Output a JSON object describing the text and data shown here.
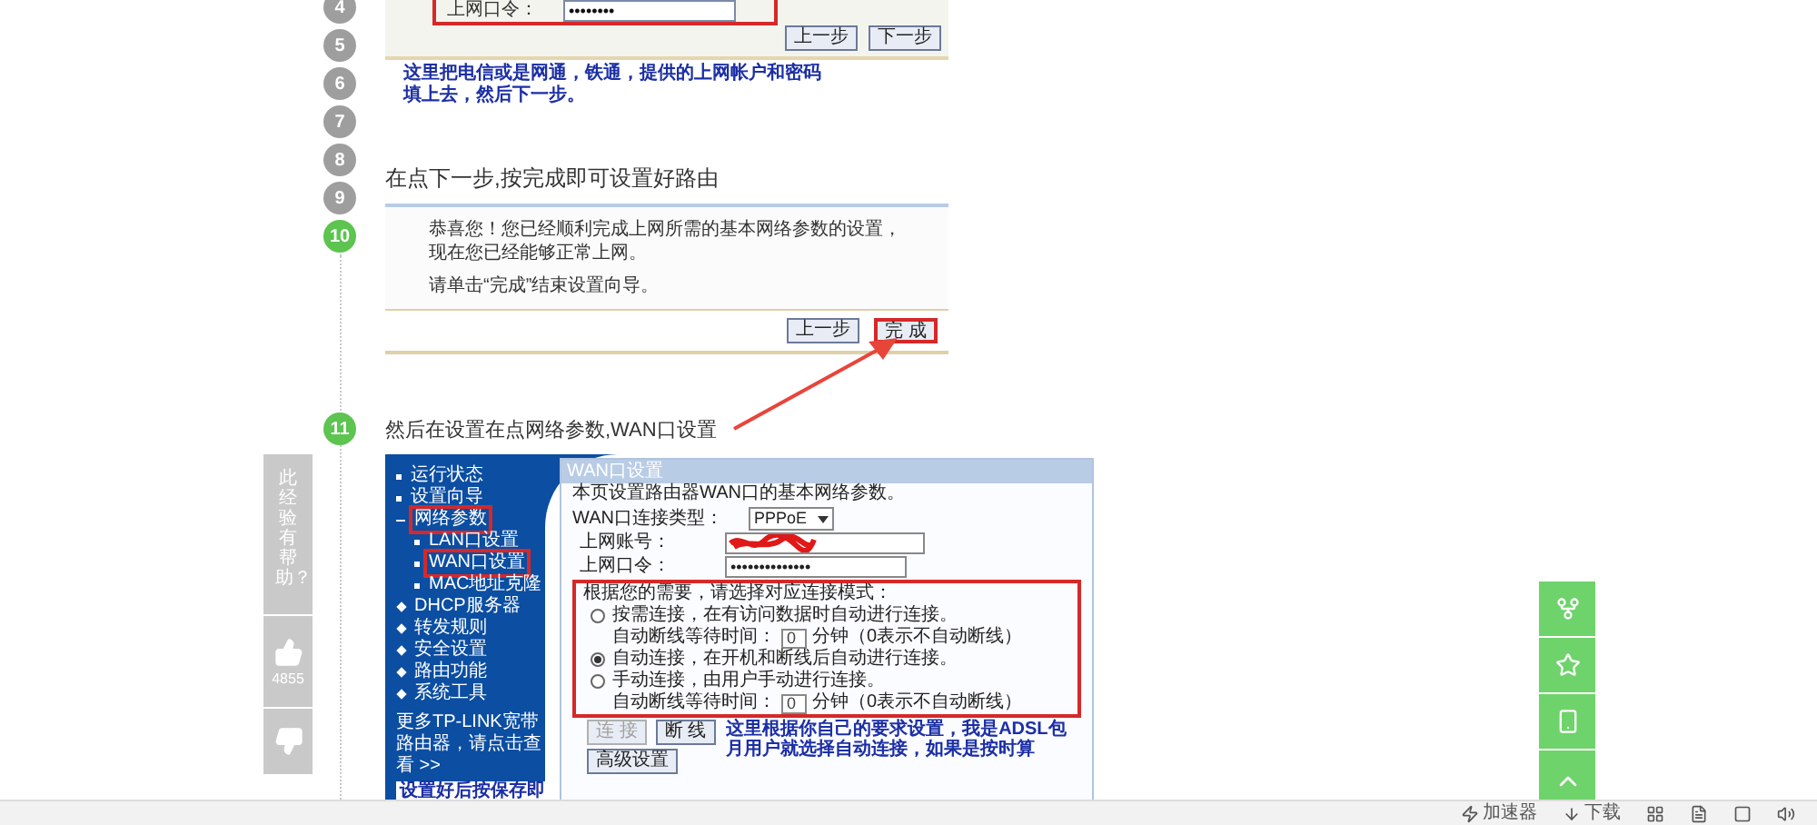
{
  "step_nav": [
    {
      "number": "4",
      "active": false
    },
    {
      "number": "5",
      "active": false
    },
    {
      "number": "6",
      "active": false
    },
    {
      "number": "7",
      "active": false
    },
    {
      "number": "8",
      "active": false
    },
    {
      "number": "9",
      "active": false
    },
    {
      "number": "10",
      "active": true
    }
  ],
  "account_image": {
    "password_label": "上网口令：",
    "password_value": "••••••••",
    "buttons": [
      "上一步",
      "下一步"
    ],
    "note": "这里把电信或是网通，铁通，提供的上网帐户和密码填上去，然后下一步。"
  },
  "step_text": "在点下一步,按完成即可设置好路由",
  "finish_image": {
    "message": "恭喜您！您已经顺利完成上网所需的基本网络参数的设置，现在您已经能够正常上网。",
    "instruction": "请单击“完成”结束设置向导。",
    "buttons": [
      {
        "label": "上一步",
        "highlighted": false
      },
      {
        "label": "完 成",
        "highlighted": true
      }
    ]
  },
  "step_11": {
    "number": "11",
    "active": true,
    "text": "然后在设置在点网络参数,WAN口设置"
  },
  "wan_image": {
    "menu": [
      {
        "label": "运行状态",
        "kind": "link",
        "highlighted": false
      },
      {
        "label": "设置向导",
        "kind": "link",
        "highlighted": false
      },
      {
        "label": "网络参数",
        "kind": "group",
        "expanded": true,
        "highlighted": true,
        "children": [
          {
            "label": "LAN口设置",
            "highlighted": false
          },
          {
            "label": "WAN口设置",
            "highlighted": true
          },
          {
            "label": "MAC地址克隆",
            "highlighted": false
          }
        ]
      },
      {
        "label": "DHCP服务器",
        "kind": "group",
        "expanded": false,
        "highlighted": false
      },
      {
        "label": "转发规则",
        "kind": "group",
        "expanded": false,
        "highlighted": false
      },
      {
        "label": "安全设置",
        "kind": "group",
        "expanded": false,
        "highlighted": false
      },
      {
        "label": "路由功能",
        "kind": "group",
        "expanded": false,
        "highlighted": false
      },
      {
        "label": "系统工具",
        "kind": "group",
        "expanded": false,
        "highlighted": false
      }
    ],
    "more_link": "更多TP-LINK宽带路由器，请点击查看 >>",
    "panel_title": "WAN口设置",
    "description": "本页设置路由器WAN口的基本网络参数。",
    "connection_type": {
      "label": "WAN口连接类型：",
      "value": "PPPoE"
    },
    "account": {
      "label": "上网账号："
    },
    "password": {
      "label": "上网口令：",
      "value": "••••••••••••••"
    },
    "mode_prompt": "根据您的需要，请选择对应连接模式：",
    "modes": [
      {
        "label": "按需连接，在有访问数据时自动进行连接。",
        "selected": false,
        "wait": {
          "label": "自动断线等待时间：",
          "value": "0",
          "unit": "分钟（0表示不自动断线）"
        }
      },
      {
        "label": "自动连接，在开机和断线后自动进行连接。",
        "selected": true
      },
      {
        "label": "手动连接，由用户手动进行连接。",
        "selected": false,
        "wait": {
          "label": "自动断线等待时间：",
          "value": "0",
          "unit": "分钟（0表示不自动断线）"
        }
      }
    ],
    "buttons": [
      {
        "label": "连 接",
        "disabled": true
      },
      {
        "label": "断 线",
        "disabled": false
      }
    ],
    "advanced_button": "高级设置",
    "note": "这里根据你自己的要求设置，我是ADSL包月用户就选择自动连接，如果是按时算",
    "save_note": "设置好后按保存即"
  },
  "feedback": {
    "question": "此经验有帮助？",
    "likes": "4855"
  },
  "bottom_bar": [
    {
      "label": "加速器",
      "kind": "accelerator"
    },
    {
      "label": "下载",
      "kind": "download"
    },
    {
      "kind": "grid"
    },
    {
      "kind": "document"
    },
    {
      "kind": "window"
    },
    {
      "kind": "sound"
    }
  ]
}
